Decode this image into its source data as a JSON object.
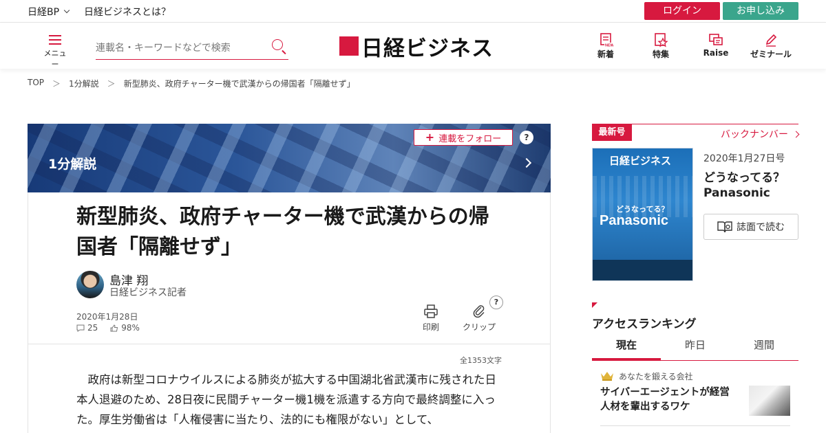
{
  "topbar": {
    "brand_menu": "日経BP",
    "about_link": "日経ビジネスとは？",
    "login_label": "ログイン",
    "signup_label": "お申し込み"
  },
  "header": {
    "menu_label": "メニュー",
    "search_placeholder": "連載名・キーワードなどで検索",
    "logo_text": "日経ビジネス",
    "nav": [
      {
        "label": "新着",
        "icon": "new-icon"
      },
      {
        "label": "特集",
        "icon": "feature-icon"
      },
      {
        "label": "Raise",
        "icon": "raise-icon"
      },
      {
        "label": "ゼミナール",
        "icon": "pen-icon"
      }
    ]
  },
  "breadcrumb": {
    "items": [
      "TOP",
      "1分解説",
      "新型肺炎、政府チャーター機で武漢からの帰国者「隔離せず」"
    ],
    "separator": "＞"
  },
  "series": {
    "title": "1分解説",
    "follow_label": "連載をフォロー",
    "help": "?"
  },
  "article": {
    "headline": "新型肺炎、政府チャーター機で武漢からの帰国者「隔離せず」",
    "author_name": "島津 翔",
    "author_role": "日経ビジネス記者",
    "date": "2020年1月28日",
    "comments": "25",
    "likes": "98%",
    "print_label": "印刷",
    "clip_label": "クリップ",
    "help": "?",
    "char_count": "全1353文字",
    "body": "政府は新型コロナウイルスによる肺炎が拡大する中国湖北省武漢市に残された日本人退避のため、28日夜に民間チャーター機1機を派遣する方向で最終調整に入った。厚生労働省は「人権侵害に当たり、法的にも権限がない」として、"
  },
  "sidebar": {
    "latest_badge": "最新号",
    "back_numbers": "バックナンバー",
    "cover": {
      "masthead": "日経ビジネス",
      "question": "どうなってる？",
      "brand": "Panasonic"
    },
    "issue_date": "2020年1月27日号",
    "issue_title_line1": "どうなってる？",
    "issue_title_line2": "Panasonic",
    "read_label": "誌面で読む",
    "ranking_title": "アクセスランキング",
    "tabs": [
      "現在",
      "昨日",
      "週間"
    ],
    "top_item": {
      "category": "あなたを鍛える会社",
      "title": "サイバーエージェントが経営人材を輩出するワケ"
    }
  },
  "colors": {
    "accent": "#d7193f",
    "signup": "#3aa58c"
  }
}
